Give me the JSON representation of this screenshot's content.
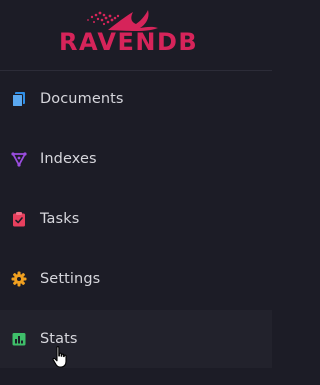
{
  "brand": {
    "name": "RAVENDB",
    "color": "#d6245a"
  },
  "nav": {
    "items": [
      {
        "label": "Documents",
        "icon": "documents-icon",
        "color": "#2f8fe8"
      },
      {
        "label": "Indexes",
        "icon": "indexes-icon",
        "color": "#9b4de0"
      },
      {
        "label": "Tasks",
        "icon": "tasks-icon",
        "color": "#e8405e"
      },
      {
        "label": "Settings",
        "icon": "settings-icon",
        "color": "#f0a020"
      },
      {
        "label": "Stats",
        "icon": "stats-icon",
        "color": "#3fbf6a"
      }
    ],
    "hovered": "Stats"
  }
}
